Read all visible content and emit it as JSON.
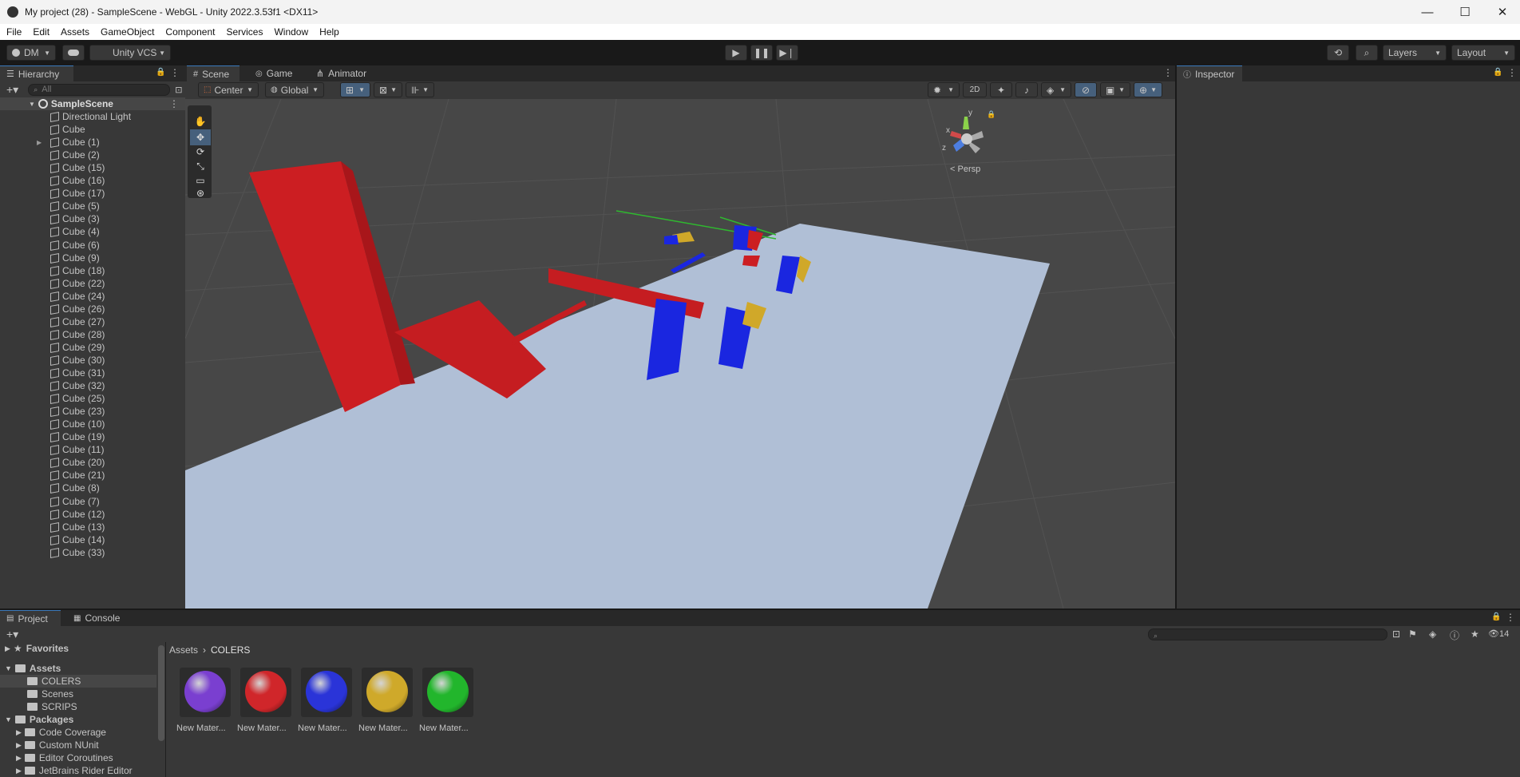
{
  "window": {
    "title": "My project (28) - SampleScene - WebGL - Unity 2022.3.53f1 <DX11>",
    "minimize": "—",
    "maximize": "☐",
    "close": "✕"
  },
  "menu": [
    "File",
    "Edit",
    "Assets",
    "GameObject",
    "Component",
    "Services",
    "Window",
    "Help"
  ],
  "toolbar": {
    "account": "DM",
    "vcs": "Unity VCS",
    "layers": "Layers",
    "layout": "Layout"
  },
  "hierarchy": {
    "tab": "Hierarchy",
    "search_placeholder": "All",
    "scene": "SampleScene",
    "items": [
      "Directional Light",
      "Cube",
      "Cube (1)",
      "Cube (2)",
      "Cube (15)",
      "Cube (16)",
      "Cube (17)",
      "Cube (5)",
      "Cube (3)",
      "Cube (4)",
      "Cube (6)",
      "Cube (9)",
      "Cube (18)",
      "Cube (22)",
      "Cube (24)",
      "Cube (26)",
      "Cube (27)",
      "Cube (28)",
      "Cube (29)",
      "Cube (30)",
      "Cube (31)",
      "Cube (32)",
      "Cube (25)",
      "Cube (23)",
      "Cube (10)",
      "Cube (19)",
      "Cube (11)",
      "Cube (20)",
      "Cube (21)",
      "Cube (8)",
      "Cube (7)",
      "Cube (12)",
      "Cube (13)",
      "Cube (14)",
      "Cube (33)"
    ]
  },
  "scene_view": {
    "tabs": [
      "Scene",
      "Game",
      "Animator"
    ],
    "pivot": "Center",
    "space": "Global",
    "mode_2d": "2D",
    "persp": "Persp",
    "gizmo_axes": {
      "y": "y",
      "x": "x",
      "z": "z"
    }
  },
  "inspector": {
    "tab": "Inspector"
  },
  "project": {
    "tabs": [
      "Project",
      "Console"
    ],
    "tree": {
      "favorites": "Favorites",
      "assets": "Assets",
      "asset_folders": [
        "COLERS",
        "Scenes",
        "SCRIPS"
      ],
      "packages": "Packages",
      "package_folders": [
        "Code Coverage",
        "Custom NUnit",
        "Editor Coroutines",
        "JetBrains Rider Editor"
      ]
    },
    "breadcrumb": [
      "Assets",
      "COLERS"
    ],
    "hidden_count": "14",
    "materials": [
      {
        "label": "New Mater...",
        "color": "#7a3fd0"
      },
      {
        "label": "New Mater...",
        "color": "#d0262a"
      },
      {
        "label": "New Mater...",
        "color": "#2a34d8"
      },
      {
        "label": "New Mater...",
        "color": "#cfa92a"
      },
      {
        "label": "New Mater...",
        "color": "#22b62c"
      }
    ]
  }
}
